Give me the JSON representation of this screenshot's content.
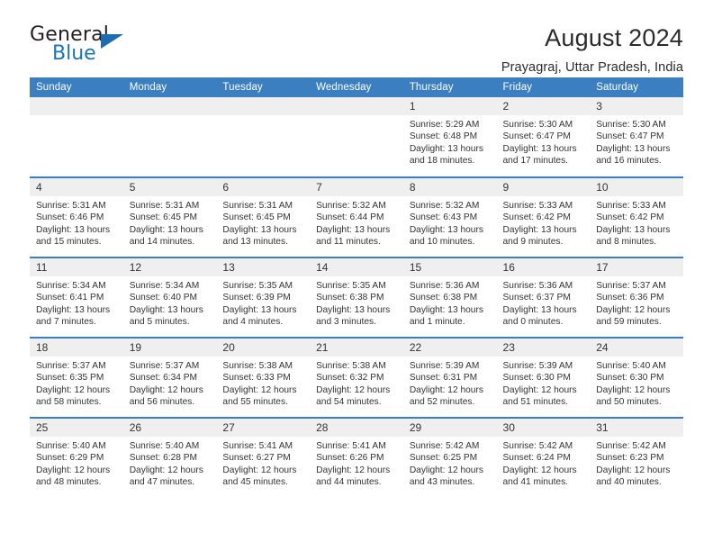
{
  "brand": {
    "word1": "General",
    "word2": "Blue",
    "flag_icon": "triangle-flag-icon"
  },
  "header": {
    "title": "August 2024",
    "subtitle": "Prayagraj, Uttar Pradesh, India"
  },
  "colors": {
    "header_blue": "#3c7fc1",
    "brand_blue": "#1b75bb",
    "daynum_gray": "#efefef",
    "text": "#333333"
  },
  "weekdays": [
    "Sunday",
    "Monday",
    "Tuesday",
    "Wednesday",
    "Thursday",
    "Friday",
    "Saturday"
  ],
  "weeks": [
    [
      {
        "day": "",
        "empty": true
      },
      {
        "day": "",
        "empty": true
      },
      {
        "day": "",
        "empty": true
      },
      {
        "day": "",
        "empty": true
      },
      {
        "day": "1",
        "sunrise": "Sunrise: 5:29 AM",
        "sunset": "Sunset: 6:48 PM",
        "daylight": "Daylight: 13 hours and 18 minutes."
      },
      {
        "day": "2",
        "sunrise": "Sunrise: 5:30 AM",
        "sunset": "Sunset: 6:47 PM",
        "daylight": "Daylight: 13 hours and 17 minutes."
      },
      {
        "day": "3",
        "sunrise": "Sunrise: 5:30 AM",
        "sunset": "Sunset: 6:47 PM",
        "daylight": "Daylight: 13 hours and 16 minutes."
      }
    ],
    [
      {
        "day": "4",
        "sunrise": "Sunrise: 5:31 AM",
        "sunset": "Sunset: 6:46 PM",
        "daylight": "Daylight: 13 hours and 15 minutes."
      },
      {
        "day": "5",
        "sunrise": "Sunrise: 5:31 AM",
        "sunset": "Sunset: 6:45 PM",
        "daylight": "Daylight: 13 hours and 14 minutes."
      },
      {
        "day": "6",
        "sunrise": "Sunrise: 5:31 AM",
        "sunset": "Sunset: 6:45 PM",
        "daylight": "Daylight: 13 hours and 13 minutes."
      },
      {
        "day": "7",
        "sunrise": "Sunrise: 5:32 AM",
        "sunset": "Sunset: 6:44 PM",
        "daylight": "Daylight: 13 hours and 11 minutes."
      },
      {
        "day": "8",
        "sunrise": "Sunrise: 5:32 AM",
        "sunset": "Sunset: 6:43 PM",
        "daylight": "Daylight: 13 hours and 10 minutes."
      },
      {
        "day": "9",
        "sunrise": "Sunrise: 5:33 AM",
        "sunset": "Sunset: 6:42 PM",
        "daylight": "Daylight: 13 hours and 9 minutes."
      },
      {
        "day": "10",
        "sunrise": "Sunrise: 5:33 AM",
        "sunset": "Sunset: 6:42 PM",
        "daylight": "Daylight: 13 hours and 8 minutes."
      }
    ],
    [
      {
        "day": "11",
        "sunrise": "Sunrise: 5:34 AM",
        "sunset": "Sunset: 6:41 PM",
        "daylight": "Daylight: 13 hours and 7 minutes."
      },
      {
        "day": "12",
        "sunrise": "Sunrise: 5:34 AM",
        "sunset": "Sunset: 6:40 PM",
        "daylight": "Daylight: 13 hours and 5 minutes."
      },
      {
        "day": "13",
        "sunrise": "Sunrise: 5:35 AM",
        "sunset": "Sunset: 6:39 PM",
        "daylight": "Daylight: 13 hours and 4 minutes."
      },
      {
        "day": "14",
        "sunrise": "Sunrise: 5:35 AM",
        "sunset": "Sunset: 6:38 PM",
        "daylight": "Daylight: 13 hours and 3 minutes."
      },
      {
        "day": "15",
        "sunrise": "Sunrise: 5:36 AM",
        "sunset": "Sunset: 6:38 PM",
        "daylight": "Daylight: 13 hours and 1 minute."
      },
      {
        "day": "16",
        "sunrise": "Sunrise: 5:36 AM",
        "sunset": "Sunset: 6:37 PM",
        "daylight": "Daylight: 13 hours and 0 minutes."
      },
      {
        "day": "17",
        "sunrise": "Sunrise: 5:37 AM",
        "sunset": "Sunset: 6:36 PM",
        "daylight": "Daylight: 12 hours and 59 minutes."
      }
    ],
    [
      {
        "day": "18",
        "sunrise": "Sunrise: 5:37 AM",
        "sunset": "Sunset: 6:35 PM",
        "daylight": "Daylight: 12 hours and 58 minutes."
      },
      {
        "day": "19",
        "sunrise": "Sunrise: 5:37 AM",
        "sunset": "Sunset: 6:34 PM",
        "daylight": "Daylight: 12 hours and 56 minutes."
      },
      {
        "day": "20",
        "sunrise": "Sunrise: 5:38 AM",
        "sunset": "Sunset: 6:33 PM",
        "daylight": "Daylight: 12 hours and 55 minutes."
      },
      {
        "day": "21",
        "sunrise": "Sunrise: 5:38 AM",
        "sunset": "Sunset: 6:32 PM",
        "daylight": "Daylight: 12 hours and 54 minutes."
      },
      {
        "day": "22",
        "sunrise": "Sunrise: 5:39 AM",
        "sunset": "Sunset: 6:31 PM",
        "daylight": "Daylight: 12 hours and 52 minutes."
      },
      {
        "day": "23",
        "sunrise": "Sunrise: 5:39 AM",
        "sunset": "Sunset: 6:30 PM",
        "daylight": "Daylight: 12 hours and 51 minutes."
      },
      {
        "day": "24",
        "sunrise": "Sunrise: 5:40 AM",
        "sunset": "Sunset: 6:30 PM",
        "daylight": "Daylight: 12 hours and 50 minutes."
      }
    ],
    [
      {
        "day": "25",
        "sunrise": "Sunrise: 5:40 AM",
        "sunset": "Sunset: 6:29 PM",
        "daylight": "Daylight: 12 hours and 48 minutes."
      },
      {
        "day": "26",
        "sunrise": "Sunrise: 5:40 AM",
        "sunset": "Sunset: 6:28 PM",
        "daylight": "Daylight: 12 hours and 47 minutes."
      },
      {
        "day": "27",
        "sunrise": "Sunrise: 5:41 AM",
        "sunset": "Sunset: 6:27 PM",
        "daylight": "Daylight: 12 hours and 45 minutes."
      },
      {
        "day": "28",
        "sunrise": "Sunrise: 5:41 AM",
        "sunset": "Sunset: 6:26 PM",
        "daylight": "Daylight: 12 hours and 44 minutes."
      },
      {
        "day": "29",
        "sunrise": "Sunrise: 5:42 AM",
        "sunset": "Sunset: 6:25 PM",
        "daylight": "Daylight: 12 hours and 43 minutes."
      },
      {
        "day": "30",
        "sunrise": "Sunrise: 5:42 AM",
        "sunset": "Sunset: 6:24 PM",
        "daylight": "Daylight: 12 hours and 41 minutes."
      },
      {
        "day": "31",
        "sunrise": "Sunrise: 5:42 AM",
        "sunset": "Sunset: 6:23 PM",
        "daylight": "Daylight: 12 hours and 40 minutes."
      }
    ]
  ]
}
